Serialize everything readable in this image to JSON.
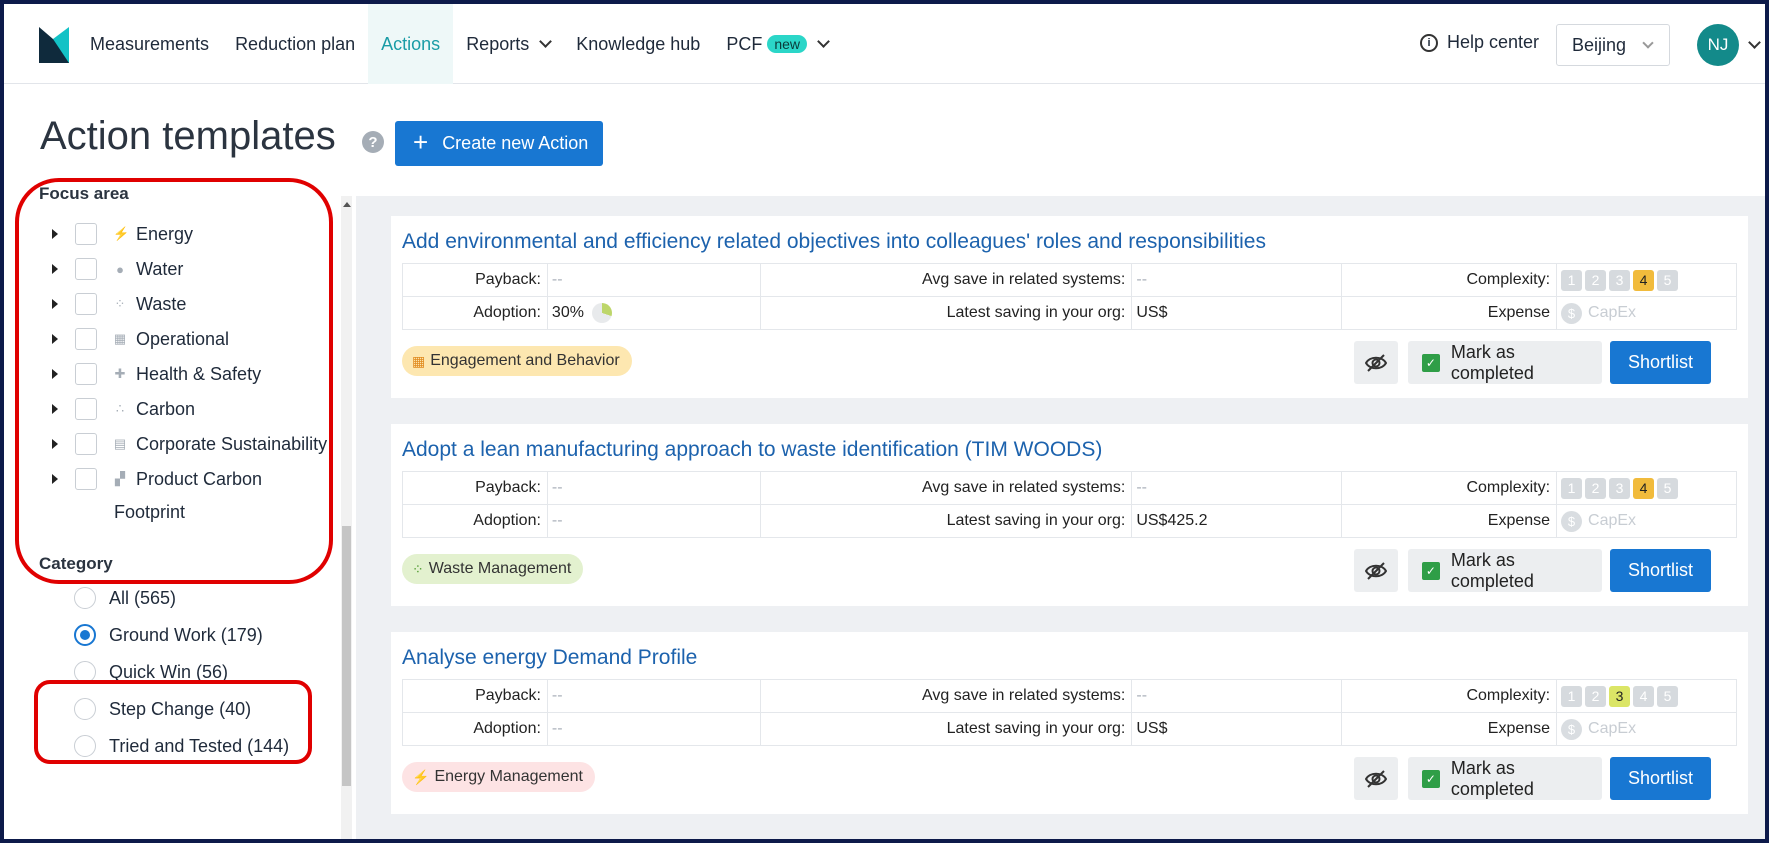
{
  "nav": {
    "items": [
      {
        "label": "Measurements"
      },
      {
        "label": "Reduction plan"
      },
      {
        "label": "Actions"
      },
      {
        "label": "Reports"
      },
      {
        "label": "Knowledge hub"
      },
      {
        "label": "PCF"
      }
    ],
    "pcf_badge": "new",
    "help_label": "Help center",
    "location": "Beijing",
    "avatar_initials": "NJ"
  },
  "page": {
    "title": "Action templates",
    "create_label": "Create new Action"
  },
  "sidebar": {
    "focus_title": "Focus area",
    "focus_items": [
      {
        "label": "Energy",
        "icon": "lightning-icon"
      },
      {
        "label": "Water",
        "icon": "water-drop-icon"
      },
      {
        "label": "Waste",
        "icon": "waste-dots-icon"
      },
      {
        "label": "Operational",
        "icon": "building-icon"
      },
      {
        "label": "Health & Safety",
        "icon": "health-cross-icon"
      },
      {
        "label": "Carbon",
        "icon": "carbon-dots-icon"
      },
      {
        "label": "Corporate Sustainability",
        "icon": "document-icon"
      },
      {
        "label": "Product Carbon",
        "icon": "boxes-icon"
      }
    ],
    "focus_last_wrap": "Footprint",
    "category_title": "Category",
    "categories": [
      {
        "label": "All (565)",
        "selected": false
      },
      {
        "label": "Ground Work (179)",
        "selected": true
      },
      {
        "label": "Quick Win (56)",
        "selected": false
      },
      {
        "label": "Step Change (40)",
        "selected": false
      },
      {
        "label": "Tried and Tested (144)",
        "selected": false
      }
    ]
  },
  "labels": {
    "payback": "Payback:",
    "adoption": "Adoption:",
    "avg_save": "Avg save in related systems:",
    "latest_saving": "Latest saving in your org:",
    "complexity": "Complexity:",
    "expense": "Expense",
    "capex": "CapEx",
    "mark_completed": "Mark as completed",
    "shortlist": "Shortlist"
  },
  "actions": [
    {
      "title": "Add environmental and efficiency related objectives into colleagues' roles and responsibilities",
      "payback": "--",
      "adoption": "30%",
      "adoption_fraction": 0.3,
      "avg_save": "--",
      "latest_saving": "US$",
      "complexity": 4,
      "tag": "Engagement and Behavior",
      "tag_color": "#fde7b0"
    },
    {
      "title": "Adopt a lean manufacturing approach to waste identification (TIM WOODS)",
      "payback": "--",
      "adoption": "--",
      "avg_save": "--",
      "latest_saving": "US$425.2",
      "complexity": 4,
      "tag": "Waste Management",
      "tag_color": "#e3f1cf"
    },
    {
      "title": "Analyse energy Demand Profile",
      "payback": "--",
      "adoption": "--",
      "avg_save": "--",
      "latest_saving": "US$",
      "complexity": 3,
      "tag": "Energy Management",
      "tag_color": "#fde3e4"
    }
  ],
  "colors": {
    "primary": "#1877d2",
    "accent_teal": "#1a9ca6",
    "annotation_red": "#e00000"
  }
}
